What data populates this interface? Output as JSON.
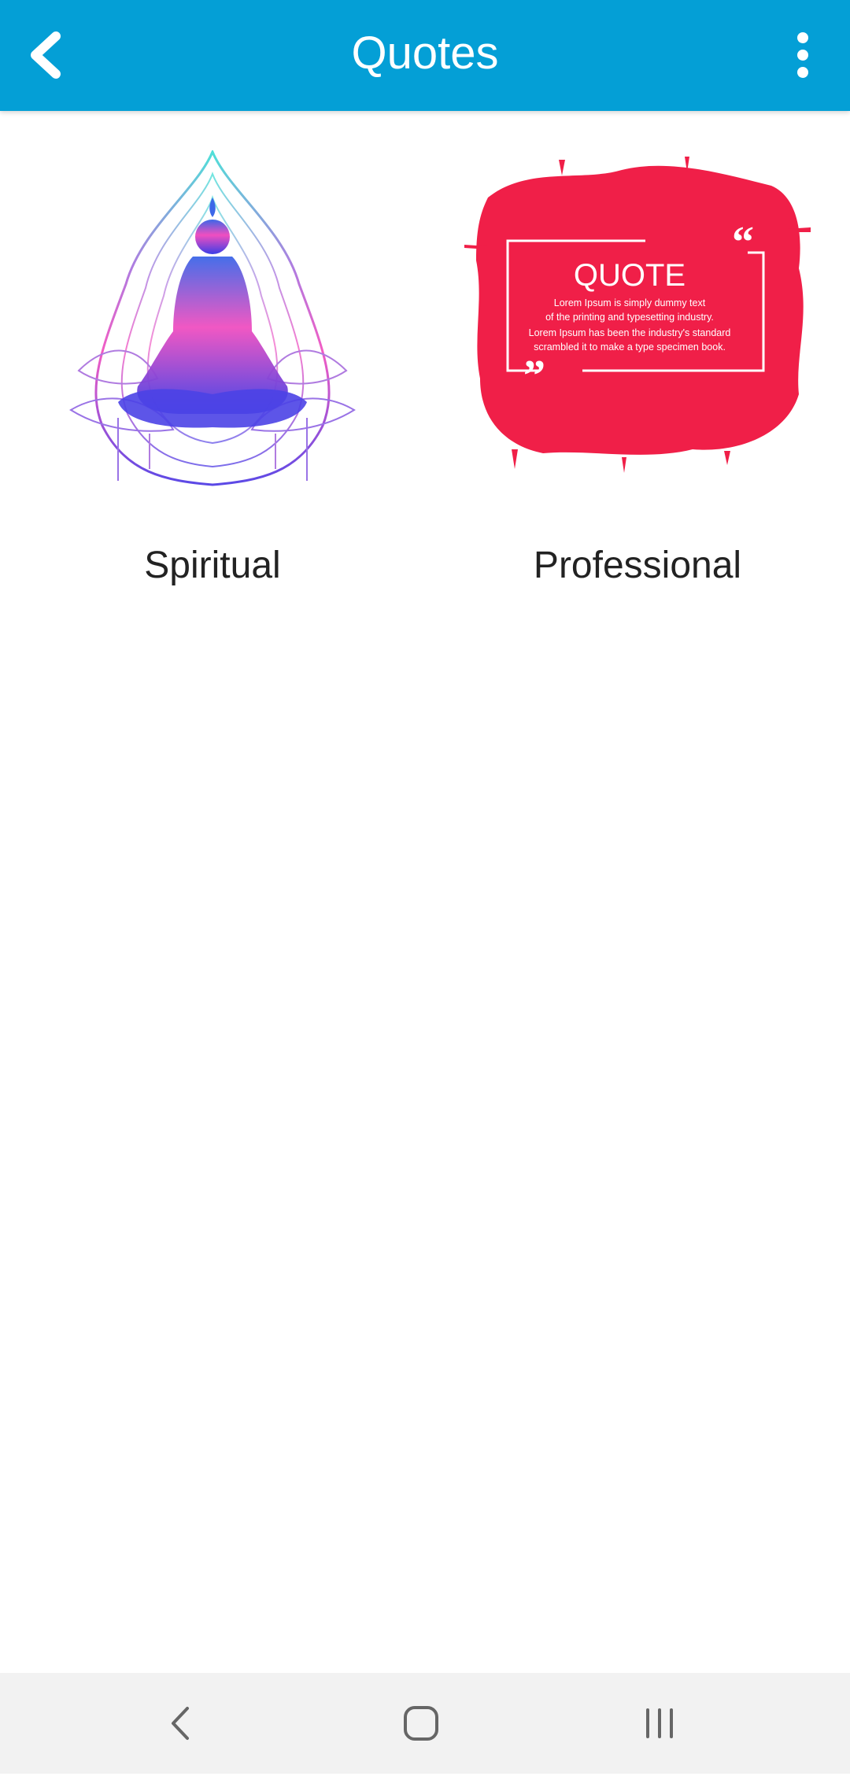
{
  "appbar": {
    "title": "Quotes",
    "back_icon": "chevron-left-icon",
    "menu_icon": "more-vertical-icon",
    "color": "#049fd6"
  },
  "cards": [
    {
      "label": "Spiritual",
      "icon": "meditation-mandala-image"
    },
    {
      "label": "Professional",
      "icon": "quote-splash-image",
      "image_text": {
        "heading": "QUOTE",
        "lines": [
          "Lorem Ipsum is simply dummy text",
          "of the printing and typesetting industry.",
          "Lorem Ipsum has been the industry's standard",
          "scrambled it to make a type specimen book."
        ]
      }
    }
  ],
  "navbar": {
    "back_icon": "nav-back-icon",
    "home_icon": "nav-home-icon",
    "recents_icon": "nav-recents-icon"
  }
}
